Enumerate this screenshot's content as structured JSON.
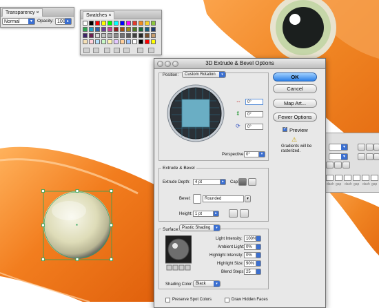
{
  "transparency": {
    "tab": "Transparency",
    "blend_mode": "Normal",
    "opacity_label": "Opacity:",
    "opacity_value": "100",
    "opacity_unit": "%"
  },
  "swatches": {
    "tab": "Swatches"
  },
  "dialog": {
    "title": "3D Extrude & Bevel Options",
    "position_label": "Position:",
    "position_value": "Custom Rotation",
    "rot_x": "0°",
    "rot_y": "0°",
    "rot_z": "0°",
    "perspective_label": "Perspective:",
    "perspective_value": "0°",
    "extrude_section": "Extrude & Bevel",
    "extrude_depth_label": "Extrude Depth:",
    "extrude_depth_value": "4 pt",
    "cap_label": "Cap:",
    "bevel_label": "Bevel:",
    "bevel_value": "Rounded",
    "height_label": "Height:",
    "height_value": "1 pt",
    "surface_label": "Surface:",
    "surface_value": "Plastic Shading",
    "light_intensity_label": "Light Intensity:",
    "light_intensity_value": "100%",
    "ambient_light_label": "Ambient Light:",
    "ambient_light_value": "0%",
    "highlight_intensity_label": "Highlight Intensity:",
    "highlight_intensity_value": "0%",
    "highlight_size_label": "Highlight Size:",
    "highlight_size_value": "90%",
    "blend_steps_label": "Blend Steps:",
    "blend_steps_value": "25",
    "shading_color_label": "Shading Color:",
    "shading_color_value": "Black",
    "preserve_spot_label": "Preserve Spot Colors",
    "draw_hidden_label": "Draw Hidden Faces",
    "ok": "OK",
    "cancel": "Cancel",
    "map_art": "Map Art...",
    "fewer_options": "Fewer Options",
    "preview": "Preview",
    "warning": "Gradients will be rasterized."
  },
  "right_panel": {
    "dash_labels": [
      "dash",
      "gap",
      "dash",
      "gap",
      "dash",
      "gap"
    ]
  },
  "colors": {
    "accent": "#2c7fe6",
    "orange": "#f07a1c",
    "cube": "#6aaec4"
  }
}
